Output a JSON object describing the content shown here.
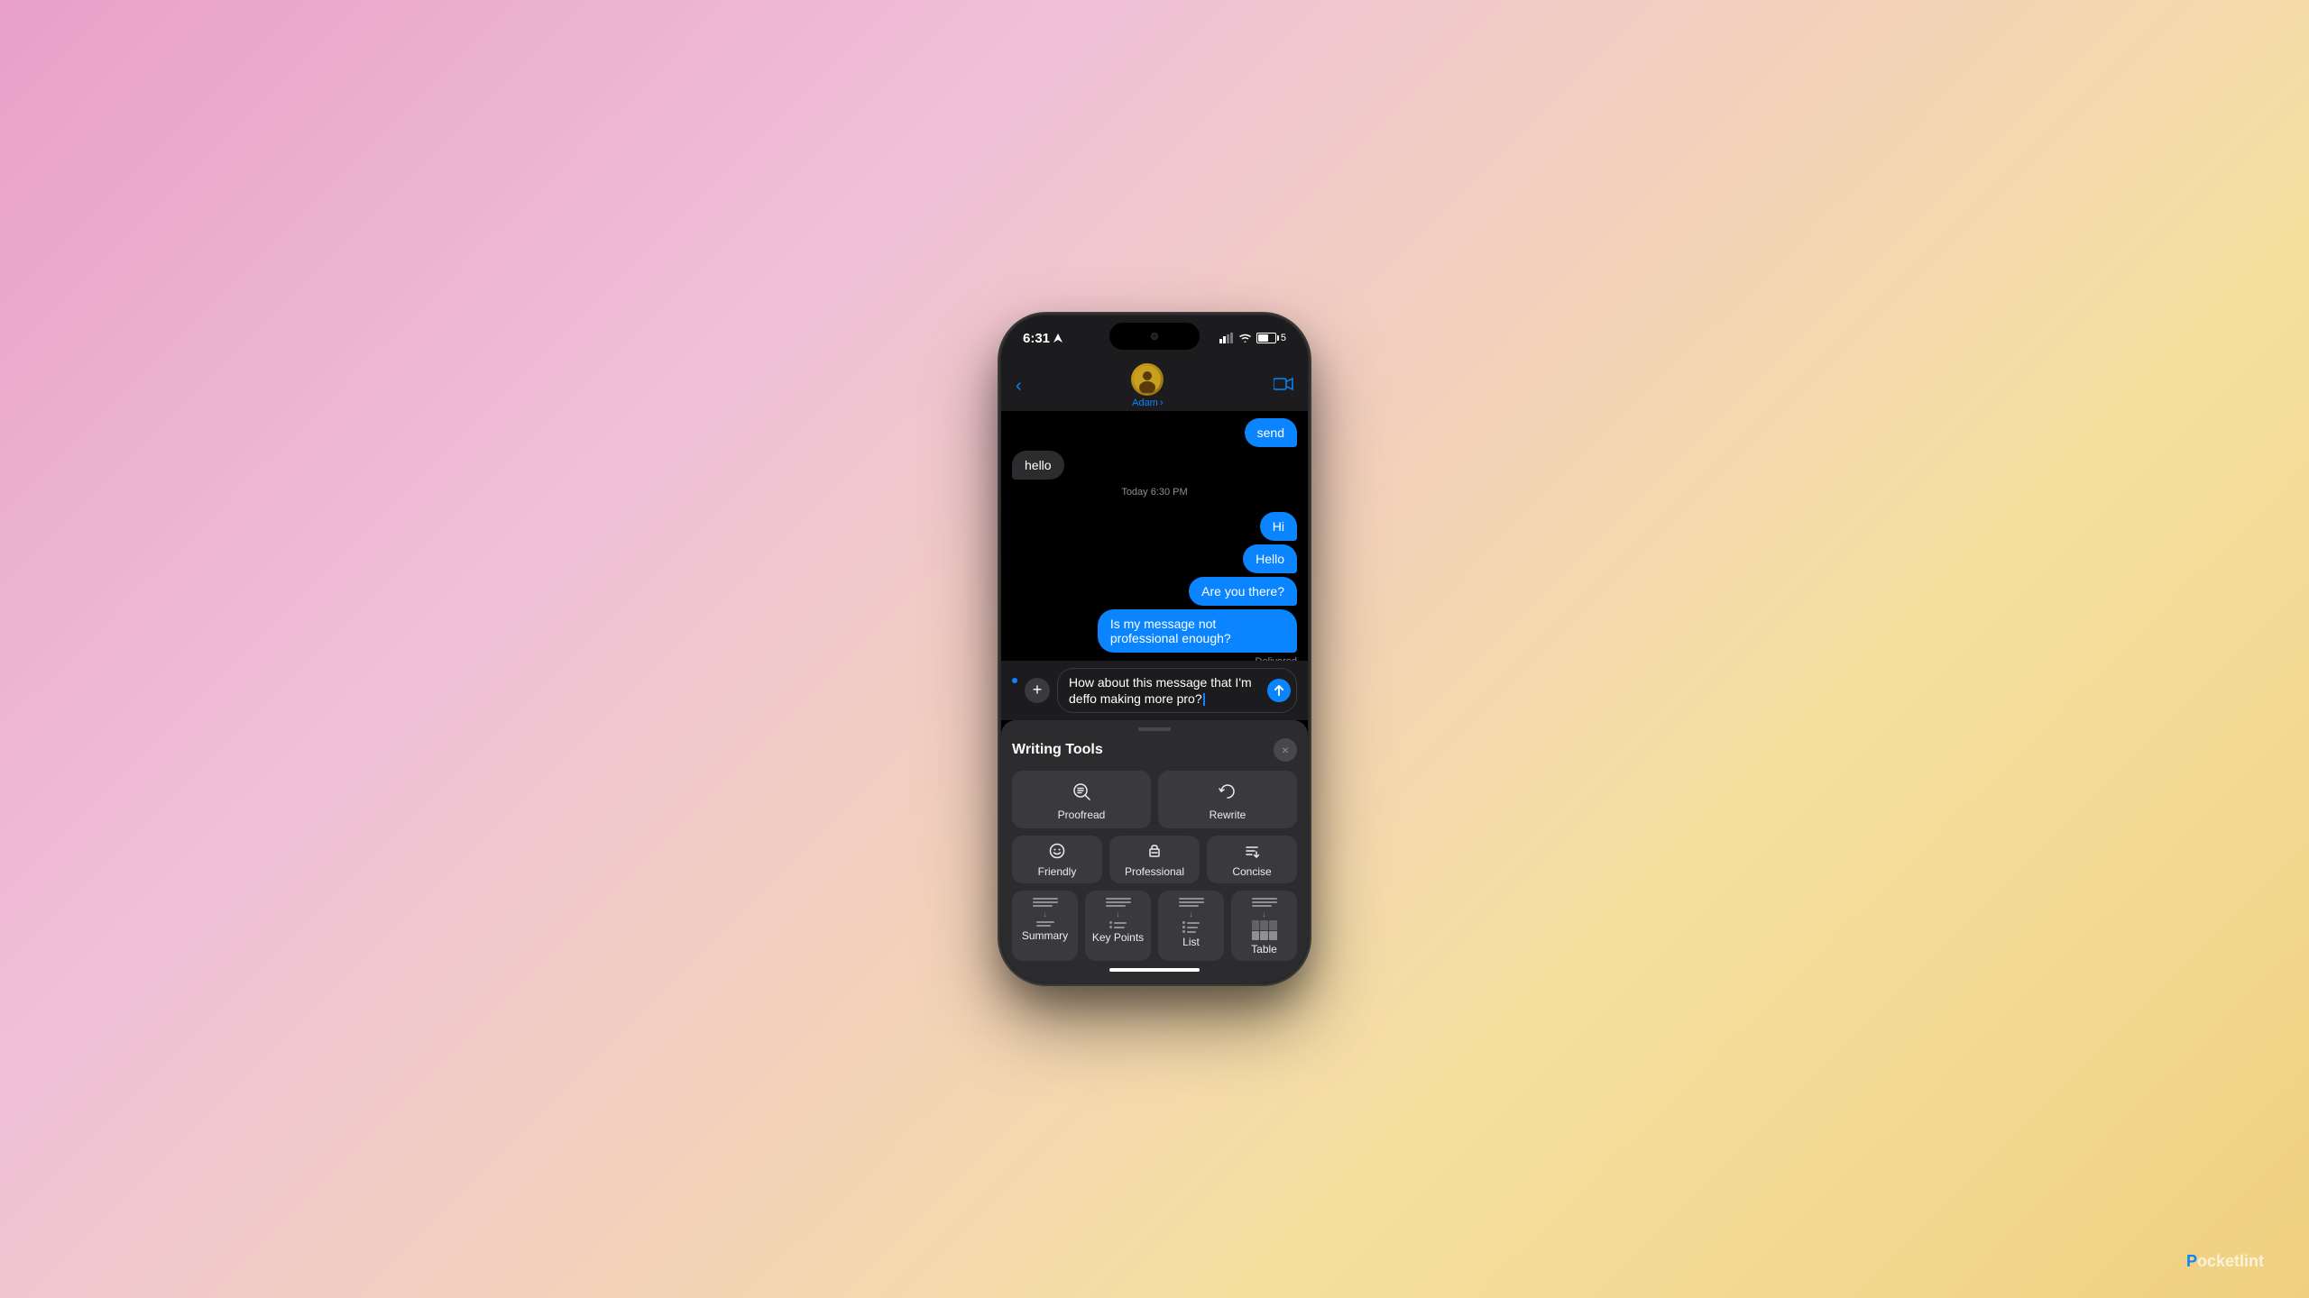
{
  "status": {
    "time": "6:31",
    "battery_label": "5"
  },
  "nav": {
    "contact_name": "Adam",
    "name_chevron": "›"
  },
  "messages": [
    {
      "type": "sent",
      "text": "send"
    },
    {
      "type": "received",
      "text": "hello"
    },
    {
      "type": "timestamp",
      "text": "Today 6:30 PM"
    },
    {
      "type": "sent",
      "text": "Hi"
    },
    {
      "type": "sent",
      "text": "Hello"
    },
    {
      "type": "sent",
      "text": "Are you there?"
    },
    {
      "type": "sent",
      "text": "Is my message not professional enough?"
    },
    {
      "type": "delivered",
      "text": "Delivered"
    }
  ],
  "input": {
    "text": "How about this message that I'm deffo making more pro?"
  },
  "writing_tools": {
    "title": "Writing Tools",
    "close_label": "×",
    "proofread_label": "Proofread",
    "rewrite_label": "Rewrite",
    "friendly_label": "Friendly",
    "professional_label": "Professional",
    "concise_label": "Concise",
    "summary_label": "Summary",
    "key_points_label": "Key Points",
    "list_label": "List",
    "table_label": "Table"
  },
  "watermark": {
    "prefix": "P",
    "text": "ocketlint"
  }
}
